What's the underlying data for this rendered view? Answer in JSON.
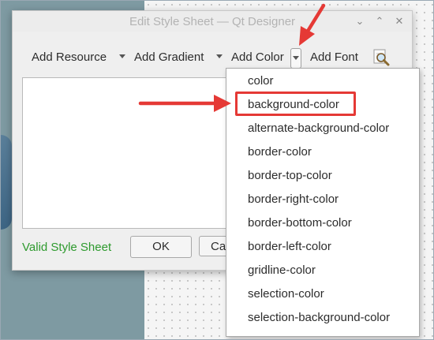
{
  "window": {
    "title": "Edit Style Sheet — Qt Designer"
  },
  "toolbar": {
    "add_resource": "Add Resource",
    "add_gradient": "Add Gradient",
    "add_color": "Add Color",
    "add_font": "Add Font"
  },
  "status": {
    "text": "Valid Style Sheet",
    "color": "#2e9a2e"
  },
  "buttons": {
    "ok": "OK",
    "cancel_partial": "Ca"
  },
  "menu": {
    "items": [
      "color",
      "background-color",
      "alternate-background-color",
      "border-color",
      "border-top-color",
      "border-right-color",
      "border-bottom-color",
      "border-left-color",
      "gridline-color",
      "selection-color",
      "selection-background-color"
    ],
    "highlighted": "background-color"
  },
  "annotation": {
    "color": "#e53935"
  }
}
